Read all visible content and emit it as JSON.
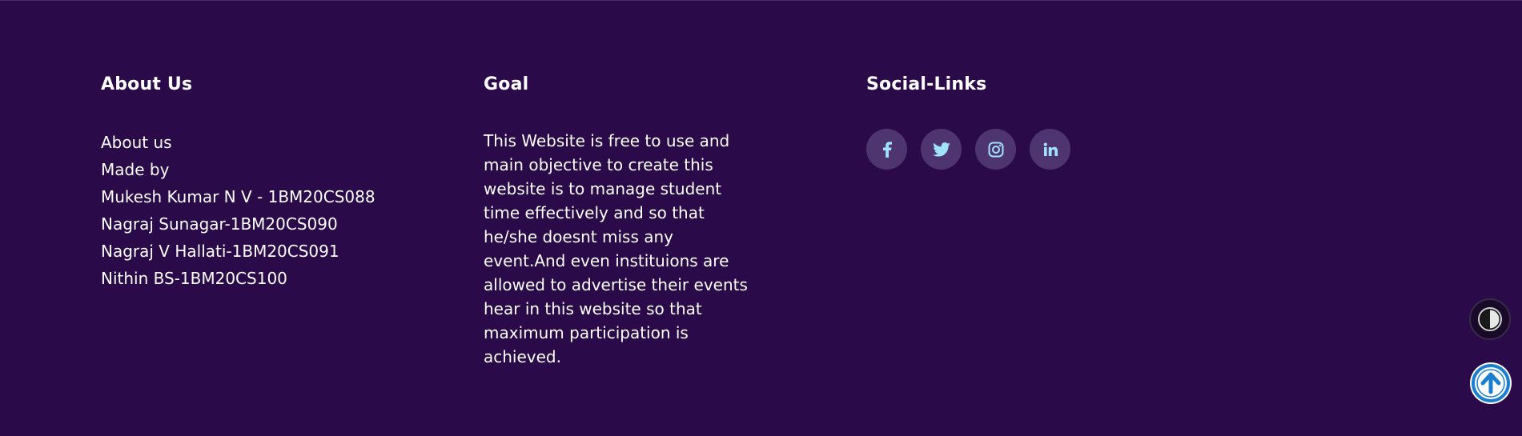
{
  "footer": {
    "about": {
      "title": "About Us",
      "items": [
        "About us",
        "Made by",
        "Mukesh Kumar N V - 1BM20CS088",
        "Nagraj Sunagar-1BM20CS090",
        "Nagraj V Hallati-1BM20CS091",
        "Nithin BS-1BM20CS100"
      ]
    },
    "goal": {
      "title": "Goal",
      "text": "This Website is free to use and main objective to create this website is to manage student time effectively and so that he/she doesnt miss any event.And even instituions are allowed to advertise their events hear in this website so that maximum participation is achieved."
    },
    "social": {
      "title": "Social-Links",
      "links": [
        {
          "icon": "facebook-icon"
        },
        {
          "icon": "twitter-icon"
        },
        {
          "icon": "instagram-icon"
        },
        {
          "icon": "linkedin-icon"
        }
      ]
    }
  },
  "floating_buttons": {
    "theme_toggle_icon": "contrast-icon",
    "scroll_top_icon": "arrow-up-circle-icon"
  },
  "colors": {
    "background": "#2a0a48",
    "text": "#ffffff",
    "social_button_bg": "#4f3570",
    "social_icon": "#9fe3ff",
    "scroll_top_accent": "#1a7fd0"
  }
}
